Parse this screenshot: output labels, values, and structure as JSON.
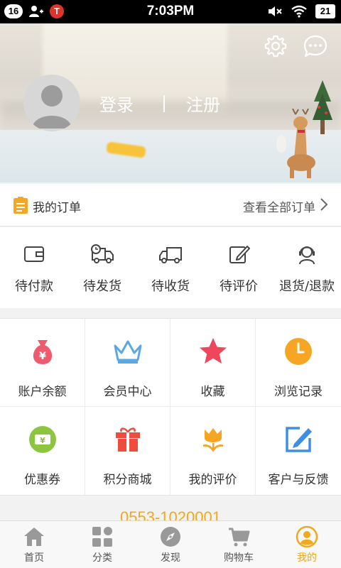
{
  "status_bar": {
    "notification_count": "16",
    "carrier_badge": "T",
    "time": "7:03PM",
    "battery": "21"
  },
  "header": {
    "login_label": "登录",
    "register_label": "注册"
  },
  "orders": {
    "title": "我的订单",
    "view_all": "查看全部订单"
  },
  "order_statuses": [
    {
      "label": "待付款",
      "icon": "wallet-icon"
    },
    {
      "label": "待发货",
      "icon": "truck-clock-icon"
    },
    {
      "label": "待收货",
      "icon": "truck-icon"
    },
    {
      "label": "待评价",
      "icon": "edit-icon"
    },
    {
      "label": "退货/退款",
      "icon": "customer-service-icon"
    }
  ],
  "services": [
    {
      "label": "账户余额",
      "icon": "money-bag-icon",
      "color": "#ef5b6e"
    },
    {
      "label": "会员中心",
      "icon": "crown-icon",
      "color": "#5aa7e6"
    },
    {
      "label": "收藏",
      "icon": "star-icon",
      "color": "#f0465b"
    },
    {
      "label": "浏览记录",
      "icon": "clock-icon",
      "color": "#f6a623"
    },
    {
      "label": "优惠券",
      "icon": "coupon-icon",
      "color": "#8cc63f"
    },
    {
      "label": "积分商城",
      "icon": "gift-icon",
      "color": "#ee4d3d"
    },
    {
      "label": "我的评价",
      "icon": "tulip-icon",
      "color": "#f6a623"
    },
    {
      "label": "客户与反馈",
      "icon": "feedback-edit-icon",
      "color": "#3f8fe0"
    }
  ],
  "phone": "0553-1020001",
  "tabs": [
    {
      "label": "首页",
      "icon": "home-icon"
    },
    {
      "label": "分类",
      "icon": "category-icon"
    },
    {
      "label": "发现",
      "icon": "compass-icon"
    },
    {
      "label": "购物车",
      "icon": "cart-icon"
    },
    {
      "label": "我的",
      "icon": "profile-icon",
      "active": true
    }
  ],
  "colors": {
    "accent": "#f0a81c",
    "tab_inactive": "#999999"
  }
}
